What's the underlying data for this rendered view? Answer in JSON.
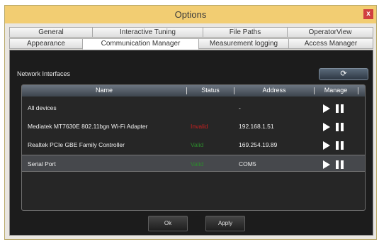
{
  "window": {
    "title": "Options",
    "close_label": "x"
  },
  "tabs_row1": [
    "General",
    "Interactive Tuning",
    "File Paths",
    "OperatorView"
  ],
  "tabs_row2": [
    "Appearance",
    "Communication Manager",
    "Measurement logging",
    "Access Manager"
  ],
  "active_tab": "Communication Manager",
  "network": {
    "label": "Network Interfaces",
    "refresh_glyph": "⟳",
    "columns": [
      "Name",
      "Status",
      "Address",
      "Manage"
    ],
    "rows": [
      {
        "name": "All devices",
        "status": "",
        "address": "-",
        "status_color": ""
      },
      {
        "name": "Mediatek MT7630E 802.11bgn Wi-Fi Adapter",
        "status": "Invalid",
        "address": "192.168.1.51",
        "status_color": "#c62020"
      },
      {
        "name": "Realtek PCIe GBE Family Controller",
        "status": "Valid",
        "address": "169.254.19.89",
        "status_color": "#2c8a2c"
      },
      {
        "name": "Serial Port",
        "status": "Valid",
        "address": "COM5",
        "status_color": "#2c8a2c"
      }
    ],
    "selected_row": 3
  },
  "buttons": {
    "ok": "Ok",
    "apply": "Apply"
  },
  "colors": {
    "titlebar": "#f2cd72",
    "panel": "#1c1c1c",
    "invalid": "#c62020",
    "valid": "#2c8a2c"
  }
}
